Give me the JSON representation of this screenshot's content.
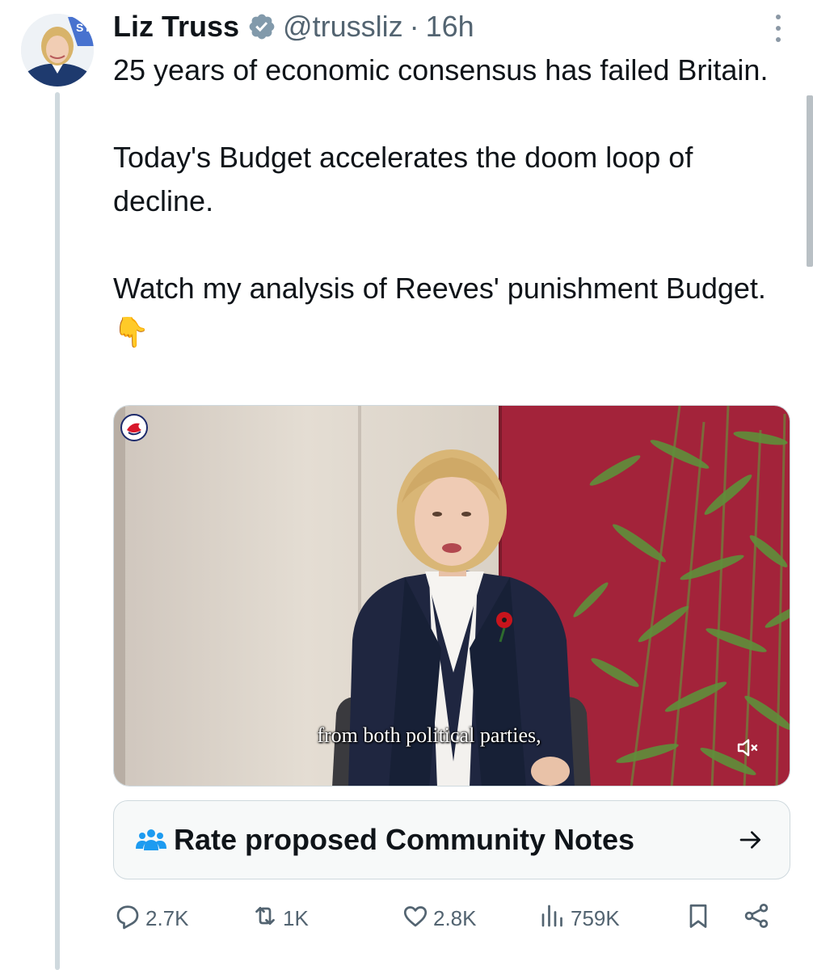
{
  "author": {
    "name": "Liz Truss",
    "handle": "@trussliz",
    "separator": "·",
    "time": "16h"
  },
  "tweet": {
    "paragraphs": [
      "25 years of economic consensus has failed Britain.",
      "Today's Budget accelerates the doom loop of decline.",
      "Watch my analysis of Reeves' punishment Budget.👇"
    ]
  },
  "media": {
    "caption": "from both political parties,",
    "muted_icon": "speaker-muted-icon"
  },
  "community_notes": {
    "label": "Rate proposed Community Notes",
    "icon": "people-icon",
    "arrow_icon": "arrow-right-icon"
  },
  "actions": {
    "replies": "2.7K",
    "reposts": "1K",
    "likes": "2.8K",
    "views": "759K"
  },
  "colors": {
    "text": "#0f1419",
    "secondary": "#536471",
    "accent_blue": "#1d9bf0",
    "verified_badge": "#829aab",
    "thread_line": "#cfd9de",
    "notes_card_bg": "#f7f9f9"
  }
}
